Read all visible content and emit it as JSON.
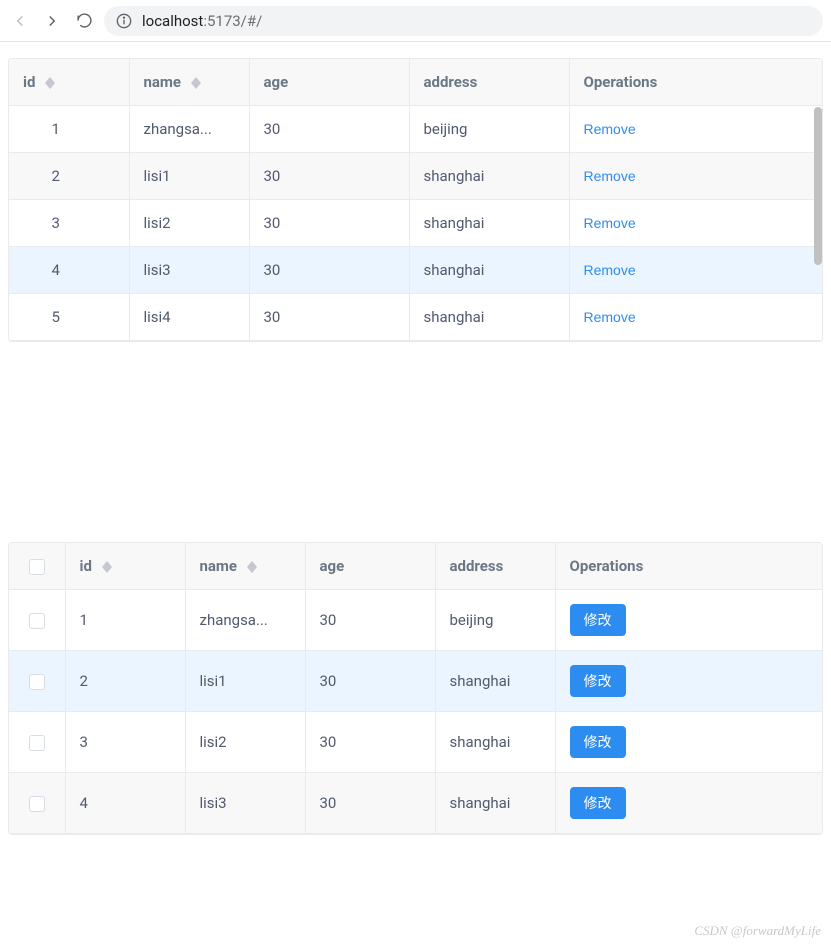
{
  "browser": {
    "url_host": "localhost",
    "url_path": ":5173/#/"
  },
  "table1": {
    "headers": {
      "id": "id",
      "name": "name",
      "age": "age",
      "address": "address",
      "operations": "Operations"
    },
    "rows": [
      {
        "id": "1",
        "name": "zhangsa...",
        "age": "30",
        "address": "beijing",
        "action": "Remove",
        "highlight": false
      },
      {
        "id": "2",
        "name": "lisi1",
        "age": "30",
        "address": "shanghai",
        "action": "Remove",
        "highlight": false
      },
      {
        "id": "3",
        "name": "lisi2",
        "age": "30",
        "address": "shanghai",
        "action": "Remove",
        "highlight": false
      },
      {
        "id": "4",
        "name": "lisi3",
        "age": "30",
        "address": "shanghai",
        "action": "Remove",
        "highlight": true
      },
      {
        "id": "5",
        "name": "lisi4",
        "age": "30",
        "address": "shanghai",
        "action": "Remove",
        "highlight": false
      }
    ]
  },
  "table2": {
    "headers": {
      "id": "id",
      "name": "name",
      "age": "age",
      "address": "address",
      "operations": "Operations"
    },
    "rows": [
      {
        "id": "1",
        "name": "zhangsa...",
        "age": "30",
        "address": "beijing",
        "action": "修改",
        "highlight": false
      },
      {
        "id": "2",
        "name": "lisi1",
        "age": "30",
        "address": "shanghai",
        "action": "修改",
        "highlight": true
      },
      {
        "id": "3",
        "name": "lisi2",
        "age": "30",
        "address": "shanghai",
        "action": "修改",
        "highlight": false
      },
      {
        "id": "4",
        "name": "lisi3",
        "age": "30",
        "address": "shanghai",
        "action": "修改",
        "highlight": false
      }
    ]
  },
  "watermark": "CSDN @forwardMyLife"
}
